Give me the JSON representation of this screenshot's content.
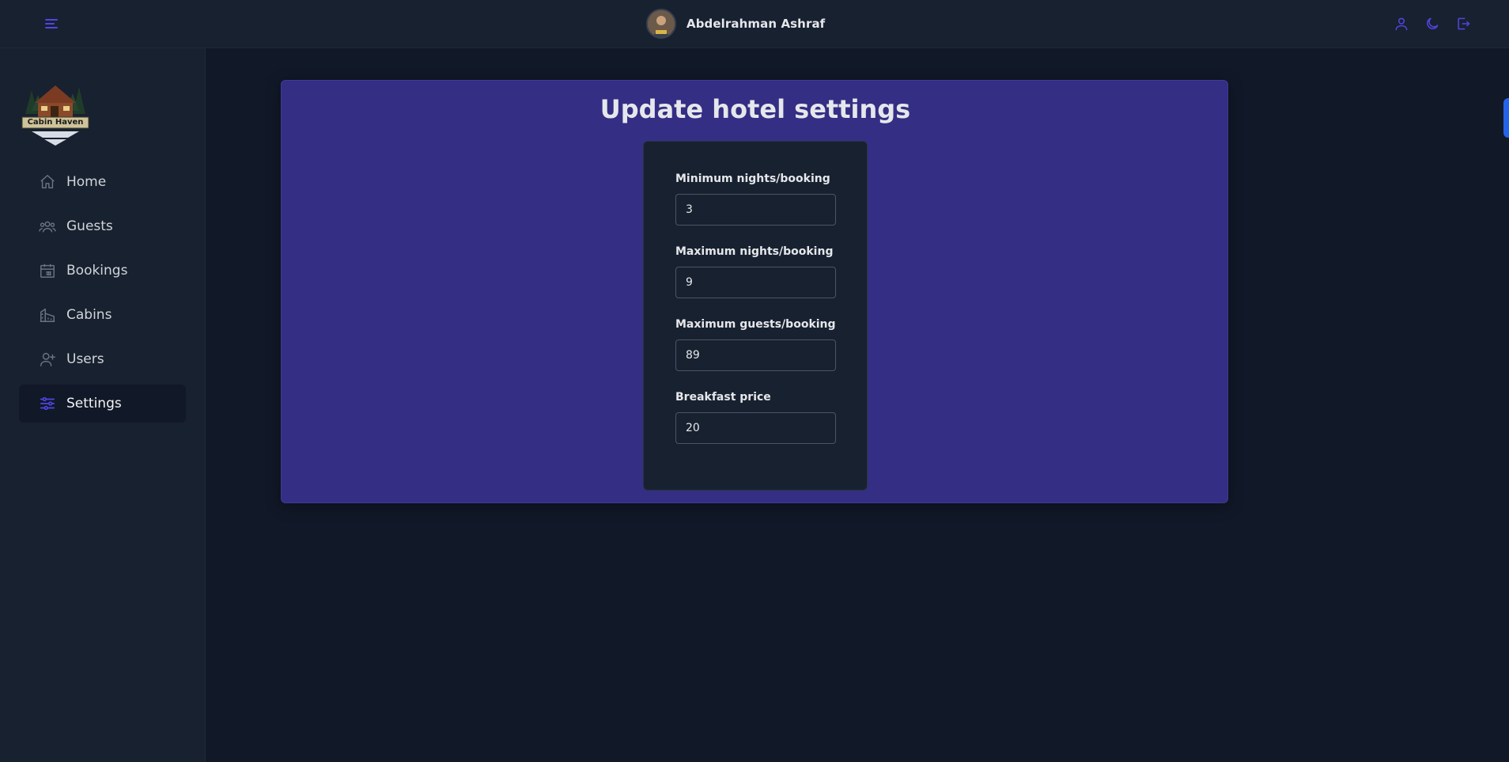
{
  "header": {
    "user_name": "Abdelrahman Ashraf",
    "icons": [
      "menu-icon",
      "user-icon",
      "moon-icon",
      "logout-icon"
    ]
  },
  "sidebar": {
    "logo_text": "Cabin Haven",
    "items": [
      {
        "label": "Home",
        "icon": "home-icon"
      },
      {
        "label": "Guests",
        "icon": "guests-icon"
      },
      {
        "label": "Bookings",
        "icon": "calendar-icon"
      },
      {
        "label": "Cabins",
        "icon": "cabin-icon"
      },
      {
        "label": "Users",
        "icon": "user-plus-icon"
      },
      {
        "label": "Settings",
        "icon": "sliders-icon",
        "active": true
      }
    ]
  },
  "main": {
    "title": "Update hotel settings",
    "fields": [
      {
        "label": "Minimum nights/booking",
        "value": "3"
      },
      {
        "label": "Maximum nights/booking",
        "value": "9"
      },
      {
        "label": "Maximum guests/booking",
        "value": "89"
      },
      {
        "label": "Breakfast price",
        "value": "20"
      }
    ]
  },
  "colors": {
    "background": "#111827",
    "surface": "#18212f",
    "panel": "#342e84",
    "accent": "#4f46e5",
    "side_tab": "#2563eb"
  }
}
